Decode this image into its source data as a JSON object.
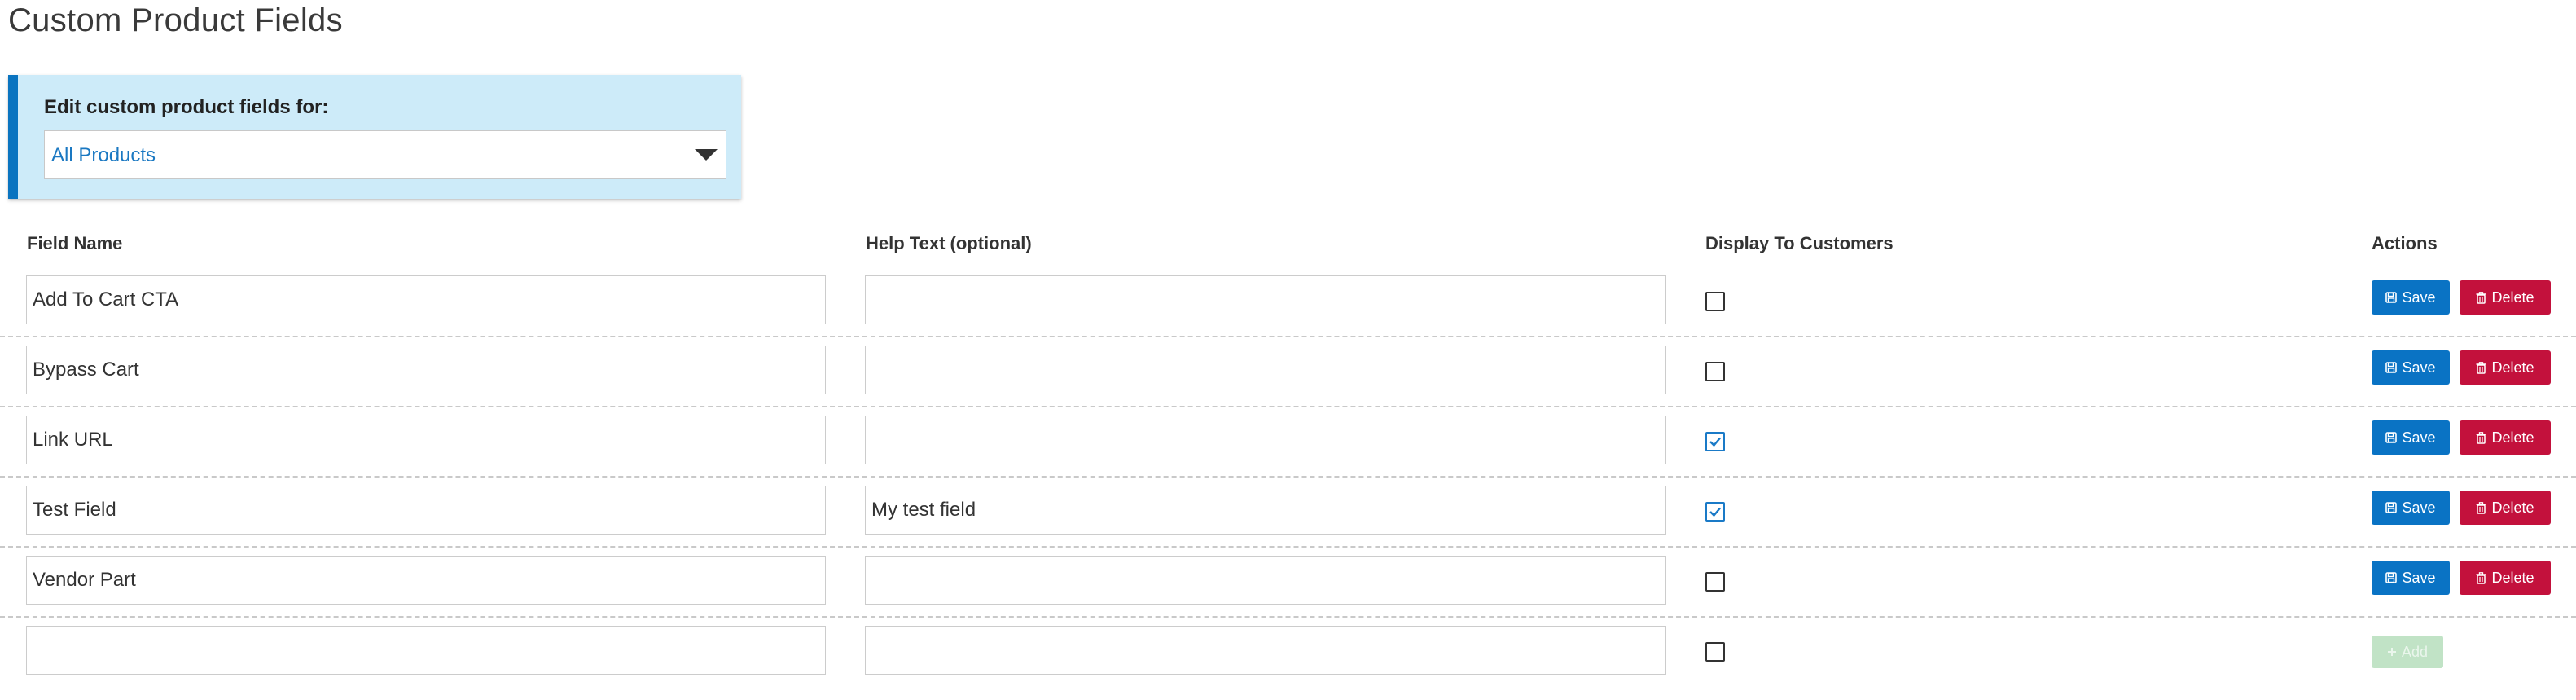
{
  "page": {
    "title": "Custom Product Fields"
  },
  "selector": {
    "label": "Edit custom product fields for:",
    "selected": "All Products"
  },
  "columns": {
    "field_name": "Field Name",
    "help_text": "Help Text (optional)",
    "display": "Display To Customers",
    "actions": "Actions"
  },
  "rows": [
    {
      "field_name": "Add To Cart CTA",
      "help_text": "",
      "display": false
    },
    {
      "field_name": "Bypass Cart",
      "help_text": "",
      "display": false
    },
    {
      "field_name": "Link URL",
      "help_text": "",
      "display": true
    },
    {
      "field_name": "Test Field",
      "help_text": "My test field",
      "display": true
    },
    {
      "field_name": "Vendor Part",
      "help_text": "",
      "display": false
    }
  ],
  "new_row": {
    "field_name": "",
    "help_text": "",
    "display": false
  },
  "buttons": {
    "save_label": "Save",
    "delete_label": "Delete",
    "add_label": "Add"
  },
  "icons": {
    "save": "floppy-disk-icon",
    "delete": "trash-icon",
    "add": "plus-icon",
    "dropdown": "chevron-down-icon"
  },
  "colors": {
    "primary": "#0a73c4",
    "danger": "#c3113c",
    "add_disabled": "#c1e3c6",
    "panel_bg": "#cdebf9",
    "panel_accent": "#0a74c0"
  }
}
